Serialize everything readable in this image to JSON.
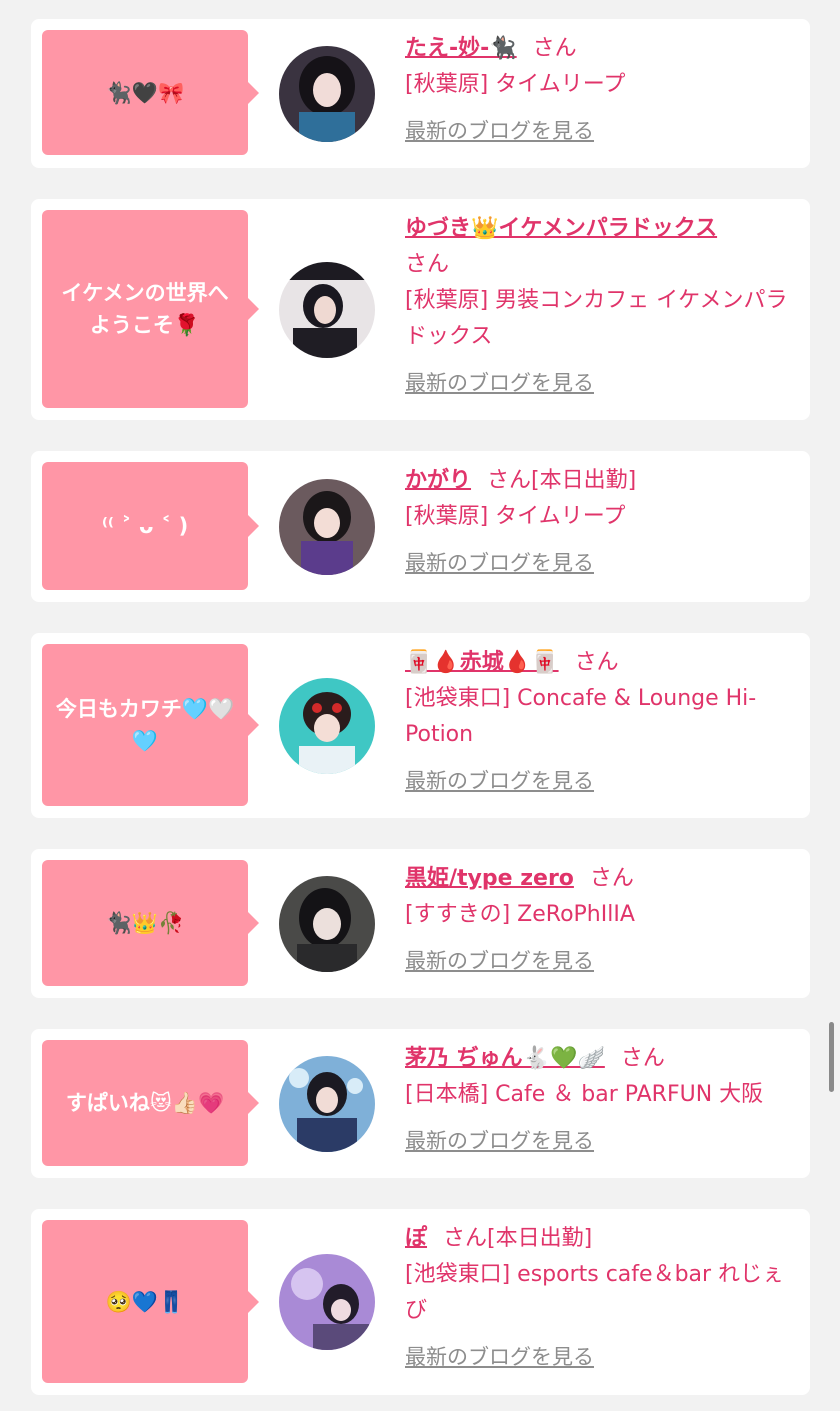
{
  "feed": {
    "items": [
      {
        "bubble": "🐈‍⬛🖤🎀",
        "name": "たえ-妙-🐈‍⬛",
        "suffix": "さん",
        "status": "",
        "shop": "[秋葉原] タイムリープ",
        "blog_link": "最新のブログを見る"
      },
      {
        "bubble": "イケメンの世界へようこそ🌹",
        "name": "ゆづき👑イケメンパラドックス",
        "suffix": "さん",
        "status": "",
        "shop": "[秋葉原] 男装コンカフェ イケメンパラドックス",
        "blog_link": "最新のブログを見る"
      },
      {
        "bubble": "⁽⁽ ˃ ᴗ ˂ )",
        "name": "かがり",
        "suffix": "さん",
        "status": "[本日出勤]",
        "shop": "[秋葉原] タイムリープ",
        "blog_link": "最新のブログを見る"
      },
      {
        "bubble": "今日もカワチ🩵🤍🩵",
        "name": "🀄🩸赤城🩸🀄",
        "suffix": "さん",
        "status": "",
        "shop": "[池袋東口] Concafe & Lounge Hi-Potion",
        "blog_link": "最新のブログを見る"
      },
      {
        "bubble": "🐈‍⬛👑🥀",
        "name": "黒姫/type zero",
        "suffix": "さん",
        "status": "",
        "shop": "[すすきの] ZeRoPhIlIA",
        "blog_link": "最新のブログを見る"
      },
      {
        "bubble": "すぱいね😻👍🏻💗",
        "name": "茅乃 ぢゅん🐇💚🪽",
        "suffix": "さん",
        "status": "",
        "shop": "[日本橋] Cafe ＆ bar PARFUN 大阪",
        "blog_link": "最新のブログを見る"
      },
      {
        "bubble": "🥺💙👖",
        "name": "ぽ",
        "suffix": "さん",
        "status": "[本日出勤]",
        "shop": "[池袋東口] esports cafe＆bar れじぇび",
        "blog_link": "最新のブログを見る"
      }
    ]
  },
  "colors": {
    "accent": "#e0346a",
    "bubble": "#ff96a6",
    "link_gray": "#8d8d8d",
    "background": "#f2f2f2"
  }
}
